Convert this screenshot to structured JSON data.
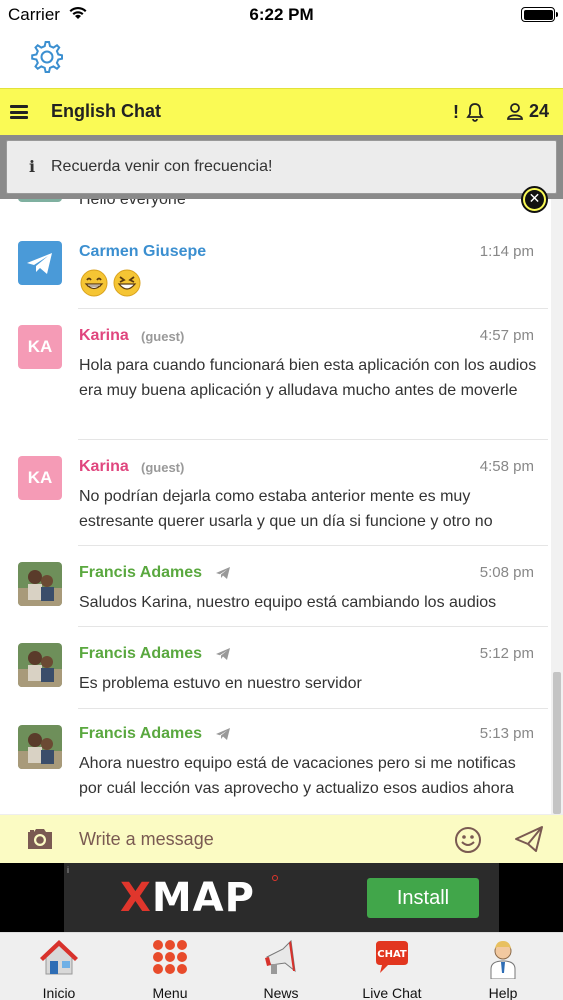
{
  "status_bar": {
    "carrier": "Carrier",
    "time": "6:22 PM"
  },
  "header": {
    "title": "English Chat",
    "alert_symbol": "!",
    "user_count": "24"
  },
  "notice": {
    "icon": "i",
    "text": "Recuerda venir con frecuencia!"
  },
  "partial_message": "Hello everyone",
  "messages": [
    {
      "name": "Carmen Giusepe",
      "time": "1:14 pm",
      "text": "",
      "emoji": "😁😆",
      "avatar": "telegram-icon"
    },
    {
      "name": "Karina",
      "guest": "(guest)",
      "avatar_initials": "KA",
      "time": "4:57 pm",
      "text": "Hola para cuando funcionará bien esta aplicación con los audios era muy buena aplicación y alludava mucho antes de moverle"
    },
    {
      "name": "Karina",
      "guest": "(guest)",
      "avatar_initials": "KA",
      "time": "4:58 pm",
      "text": "No podrían dejarla como estaba anterior mente es muy estresante querer usarla y que un día si funcione y otro no"
    },
    {
      "name": "Francis Adames",
      "time": "5:08 pm",
      "text": "Saludos Karina, nuestro equipo está cambiando los audios"
    },
    {
      "name": "Francis Adames",
      "time": "5:12 pm",
      "text": "Es problema estuvo en nuestro servidor"
    },
    {
      "name": "Francis Adames",
      "time": "5:13 pm",
      "text": "Ahora nuestro equipo está de vacaciones pero si me notificas por cuál lección vas aprovecho y actualizo esos audios ahora"
    }
  ],
  "compose": {
    "placeholder": "Write a message"
  },
  "ad": {
    "brand_x": "X",
    "brand_rest": "MAP",
    "cta": "Install",
    "info": "i"
  },
  "tabs": [
    {
      "label": "Inicio",
      "icon": "home-icon"
    },
    {
      "label": "Menu",
      "icon": "menu-grid-icon"
    },
    {
      "label": "News",
      "icon": "megaphone-icon"
    },
    {
      "label": "Live Chat",
      "icon": "chat-bubble-icon"
    },
    {
      "label": "Help",
      "icon": "support-agent-icon"
    }
  ],
  "colors": {
    "header_bg": "#fafa55",
    "compose_bg": "#fbfbc3",
    "name_blue": "#3b8fd0",
    "name_pink": "#e0467e",
    "name_green": "#5aa83f",
    "install_green": "#41a64a"
  }
}
